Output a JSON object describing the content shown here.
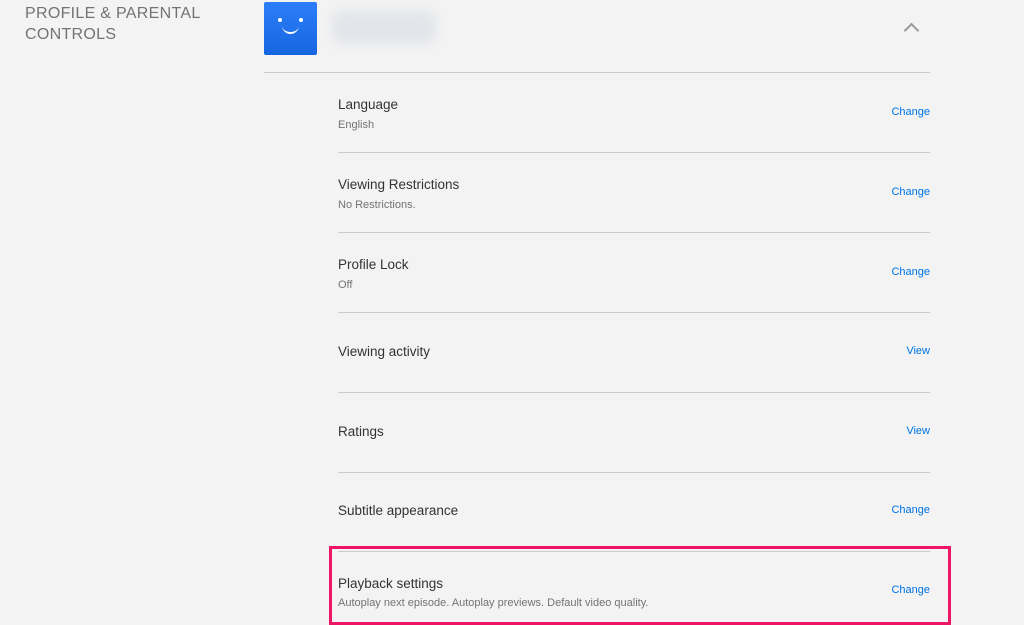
{
  "section": {
    "title": "PROFILE & PARENTAL CONTROLS"
  },
  "profile": {
    "avatar_icon": "smiley-face-icon",
    "avatar_color": "#1f73ef",
    "name_obscured": true,
    "collapse_icon": "chevron-up-icon"
  },
  "settings": [
    {
      "title": "Language",
      "value": "English",
      "action": "Change"
    },
    {
      "title": "Viewing Restrictions",
      "value": "No Restrictions.",
      "action": "Change"
    },
    {
      "title": "Profile Lock",
      "value": "Off",
      "action": "Change"
    },
    {
      "title": "Viewing activity",
      "value": "",
      "action": "View"
    },
    {
      "title": "Ratings",
      "value": "",
      "action": "View"
    },
    {
      "title": "Subtitle appearance",
      "value": "",
      "action": "Change"
    },
    {
      "title": "Playback settings",
      "value": "Autoplay next episode. Autoplay previews. Default video quality.",
      "action": "Change"
    }
  ],
  "colors": {
    "background": "#f3f3f3",
    "link": "#0073e6",
    "divider": "#cccccc",
    "highlight": "#ee1566"
  },
  "highlighted_setting": "Playback settings"
}
